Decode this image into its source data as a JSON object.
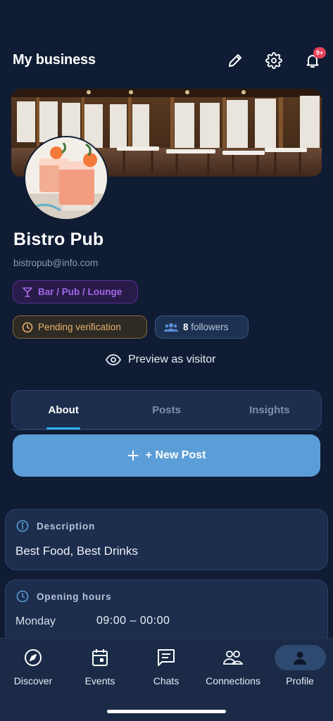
{
  "header": {
    "title": "My business",
    "notification_badge": "9+",
    "icons": [
      "pencil-icon",
      "gear-icon",
      "bell-icon"
    ]
  },
  "profile": {
    "name": "Bistro Pub",
    "email": "bistropub@info.com",
    "category": "Bar / Pub / Lounge",
    "verification_status": "Pending verification",
    "followers_count": "8",
    "followers_label": "followers",
    "preview_label": "Preview as visitor"
  },
  "tabs": [
    {
      "label": "About",
      "active": true
    },
    {
      "label": "Posts",
      "active": false
    },
    {
      "label": "Insights",
      "active": false
    }
  ],
  "new_post": {
    "label": "+ New Post"
  },
  "description": {
    "title": "Description",
    "text": "Best Food, Best Drinks"
  },
  "opening_hours": {
    "title": "Opening hours",
    "rows": [
      {
        "day": "Monday",
        "hours": "09:00 – 00:00"
      }
    ]
  },
  "bottom_nav": [
    {
      "label": "Discover",
      "icon": "compass-icon",
      "active": false
    },
    {
      "label": "Events",
      "icon": "calendar-icon",
      "active": false
    },
    {
      "label": "Chats",
      "icon": "chat-icon",
      "active": false
    },
    {
      "label": "Connections",
      "icon": "people-icon",
      "active": false
    },
    {
      "label": "Profile",
      "icon": "person-icon",
      "active": true
    }
  ],
  "colors": {
    "background": "#0f1c33",
    "card": "#1c2d4d",
    "accent_blue": "#5b9dd6",
    "tab_underline": "#2bb6f0",
    "category_purple": "#a368e6",
    "pending_amber": "#e8b46d",
    "badge_red": "#e5415a"
  }
}
